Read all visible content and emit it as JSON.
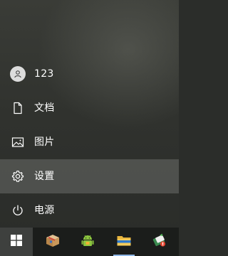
{
  "start_menu": {
    "user": {
      "label": "123",
      "icon": "user-avatar-icon"
    },
    "items": [
      {
        "label": "文档",
        "icon": "document-icon"
      },
      {
        "label": "图片",
        "icon": "pictures-icon"
      },
      {
        "label": "设置",
        "icon": "gear-icon",
        "highlighted": true
      },
      {
        "label": "电源",
        "icon": "power-icon"
      }
    ]
  },
  "taskbar": {
    "items": [
      {
        "icon": "windows-start-icon",
        "active": true
      },
      {
        "icon": "package-box-icon"
      },
      {
        "icon": "android-emulator-icon"
      },
      {
        "icon": "file-explorer-icon",
        "running": true
      },
      {
        "icon": "utility-app-icon"
      }
    ]
  },
  "colors": {
    "highlight": "rgba(255,255,255,0.16)",
    "taskbar": "#1b1d1b",
    "running_indicator": "#8fb7e6",
    "text": "#ffffff"
  }
}
